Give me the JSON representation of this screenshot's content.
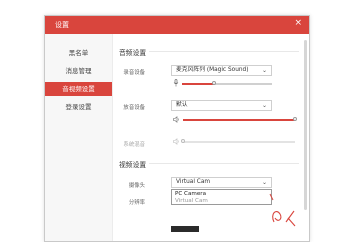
{
  "dialog": {
    "title": "设置",
    "close_glyph": "×",
    "accent": "#d9453d"
  },
  "sidebar": {
    "items": [
      {
        "label": "黑名单",
        "active": false
      },
      {
        "label": "消息管理",
        "active": false
      },
      {
        "label": "音视频设置",
        "active": true
      },
      {
        "label": "登录设置",
        "active": false
      }
    ]
  },
  "audio": {
    "section_title": "音频设置",
    "mic": {
      "label": "录音设备",
      "value": "麦克风阵列 (Magic Sound)",
      "volume_fraction": 0.35,
      "icon": "microphone-icon"
    },
    "speaker": {
      "label": "放音设备",
      "value": "默认",
      "volume_fraction": 1.0,
      "icon": "speaker-icon"
    },
    "system_mix": {
      "label": "系统混音",
      "volume_fraction": 0.0,
      "icon": "speaker-muted-icon"
    }
  },
  "video": {
    "section_title": "视频设置",
    "camera": {
      "label": "摄像头",
      "value": "Virtual Cam",
      "options": [
        "PC Camera",
        "Virtual Cam"
      ]
    },
    "resolution": {
      "label": "分辨率"
    }
  },
  "arrow_glyph": "⌄"
}
